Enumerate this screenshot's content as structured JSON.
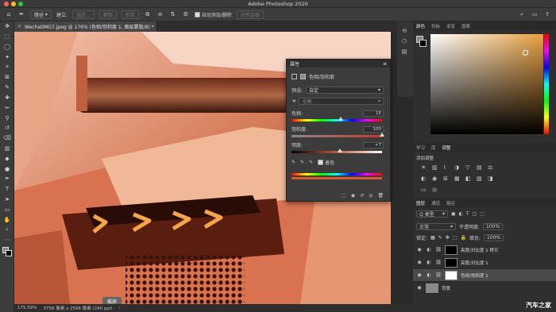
{
  "app": {
    "title": "Adobe Photoshop 2020"
  },
  "options_bar": {
    "mode_label": "路径",
    "build_label": "建立:",
    "selection_btn": "选区...",
    "mask_btn": "蒙版",
    "shape_btn": "形状",
    "auto_add_delete": "自动添加/删除",
    "align_edges": "对齐边缘"
  },
  "document": {
    "tab_label": "WechatIMG7.jpeg @ 176% (色相/饱和度 1, 图层蒙版/8) *",
    "zoom": "175.59%",
    "dimensions": "3758 像素 x 2596 像素 (240 ppi)",
    "screenshot_label": "截屏"
  },
  "properties": {
    "panel_title": "属性",
    "adjust_name": "色相/饱和度",
    "preset_label": "预设:",
    "preset_value": "自定",
    "channel_value": "全图",
    "hue_label": "色相:",
    "hue_value": "15",
    "saturation_label": "饱和度:",
    "saturation_value": "100",
    "lightness_label": "明度:",
    "lightness_value": "+7",
    "colorize_label": "着色",
    "hue_level": 0.54,
    "saturation_level": 1.0,
    "lightness_level": 0.535
  },
  "color_panel": {
    "tabs": [
      "颜色",
      "色板",
      "渐变",
      "图案"
    ]
  },
  "adjust_panel": {
    "tabs": [
      "学习",
      "库",
      "调整"
    ],
    "add_label": "添加调整"
  },
  "layers_panel": {
    "tabs": [
      "图层",
      "通道",
      "路径"
    ],
    "filter_label": "Q 类型",
    "blend_mode": "正常",
    "opacity_label": "不透明度:",
    "opacity_value": "100%",
    "lock_label": "锁定:",
    "fill_label": "填充:",
    "fill_value": "100%",
    "layers": [
      {
        "name": "亮度/对比度 1 拷贝"
      },
      {
        "name": "亮度/对比度 1"
      },
      {
        "name": "色相/饱和度 1"
      },
      {
        "name": "背景"
      }
    ]
  },
  "watermark": "汽车之家",
  "colors": {
    "accent": "#e8a040",
    "canvas": "#c96a48"
  }
}
